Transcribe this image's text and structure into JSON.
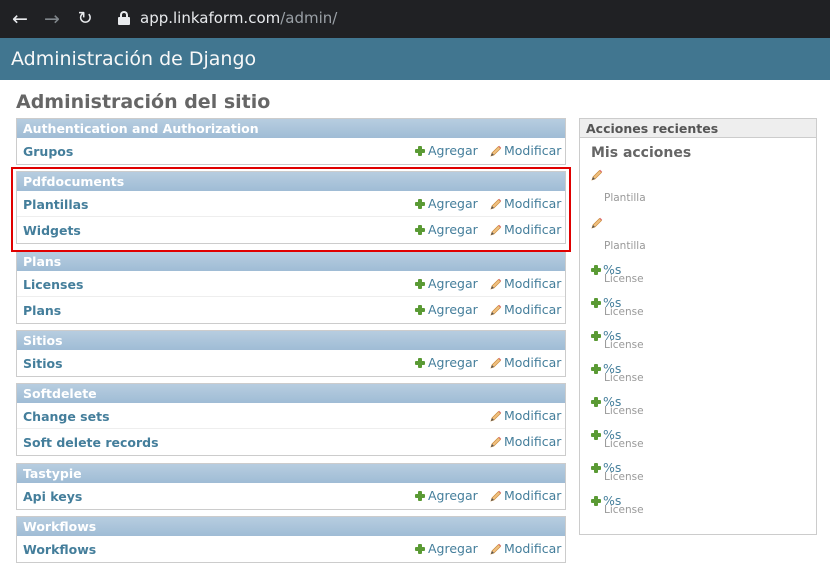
{
  "browser": {
    "url_host": "app.linkaform.com",
    "url_path": "/admin/"
  },
  "header": {
    "title": "Administración de Django"
  },
  "page_title": "Administración del sitio",
  "links": {
    "add": "Agregar",
    "change": "Modificar"
  },
  "modules": [
    {
      "name": "Authentication and Authorization",
      "models": [
        {
          "name": "Grupos",
          "add": true
        }
      ]
    },
    {
      "name": "Pdfdocuments",
      "models": [
        {
          "name": "Plantillas",
          "add": true
        },
        {
          "name": "Widgets",
          "add": true
        }
      ]
    },
    {
      "name": "Plans",
      "models": [
        {
          "name": "Licenses",
          "add": true
        },
        {
          "name": "Plans",
          "add": true
        }
      ]
    },
    {
      "name": "Sitios",
      "models": [
        {
          "name": "Sitios",
          "add": true
        }
      ]
    },
    {
      "name": "Softdelete",
      "models": [
        {
          "name": "Change sets",
          "add": false
        },
        {
          "name": "Soft delete records",
          "add": false
        }
      ]
    },
    {
      "name": "Tastypie",
      "models": [
        {
          "name": "Api keys",
          "add": true
        }
      ]
    },
    {
      "name": "Workflows",
      "models": [
        {
          "name": "Workflows",
          "add": true
        }
      ]
    }
  ],
  "recent_actions": {
    "caption": "Acciones recientes",
    "subtitle": "Mis acciones",
    "items": [
      {
        "icon": "pencil-icon",
        "label": "",
        "type": "Plantilla"
      },
      {
        "icon": "pencil-icon",
        "label": "",
        "type": "Plantilla"
      },
      {
        "icon": "plus-icon",
        "label": "%s",
        "type": "License"
      },
      {
        "icon": "plus-icon",
        "label": "%s",
        "type": "License"
      },
      {
        "icon": "plus-icon",
        "label": "%s",
        "type": "License"
      },
      {
        "icon": "plus-icon",
        "label": "%s",
        "type": "License"
      },
      {
        "icon": "plus-icon",
        "label": "%s",
        "type": "License"
      },
      {
        "icon": "plus-icon",
        "label": "%s",
        "type": "License"
      },
      {
        "icon": "plus-icon",
        "label": "%s",
        "type": "License"
      },
      {
        "icon": "plus-icon",
        "label": "%s",
        "type": "License"
      }
    ]
  },
  "colors": {
    "header_bg": "#417690",
    "module_caption_bg": "#9fbcd5",
    "link": "#447e9b",
    "highlight": "#e00000"
  }
}
